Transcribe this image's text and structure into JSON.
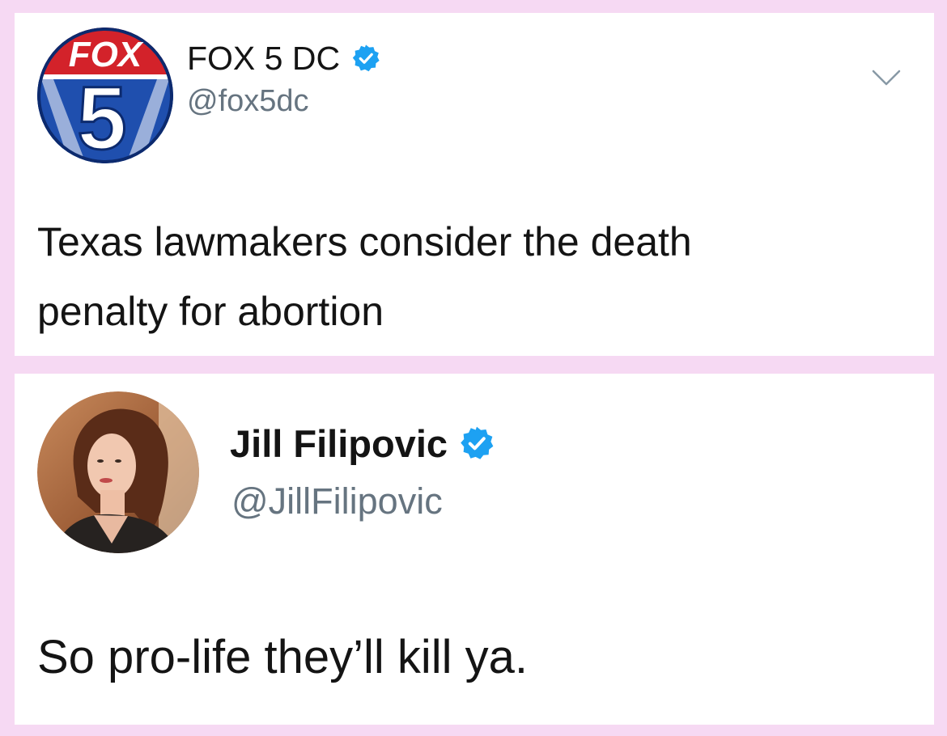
{
  "tweets": [
    {
      "avatar_icon": "fox5-logo-icon",
      "logo_text": "FOX",
      "logo_number": "5",
      "display_name": "FOX 5 DC",
      "handle": "@fox5dc",
      "verified": true,
      "text": "Texas lawmakers consider the death\npenalty for abortion",
      "menu_icon": "chevron-down-icon"
    },
    {
      "avatar_icon": "profile-photo-avatar",
      "display_name": "Jill Filipovic",
      "handle": "@JillFilipovic",
      "verified": true,
      "text": "So pro-life they’ll kill ya."
    }
  ],
  "colors": {
    "background": "#f6d9f3",
    "card": "#ffffff",
    "verified_badge": "#1da1f2",
    "handle": "#667480",
    "text": "#141414"
  }
}
